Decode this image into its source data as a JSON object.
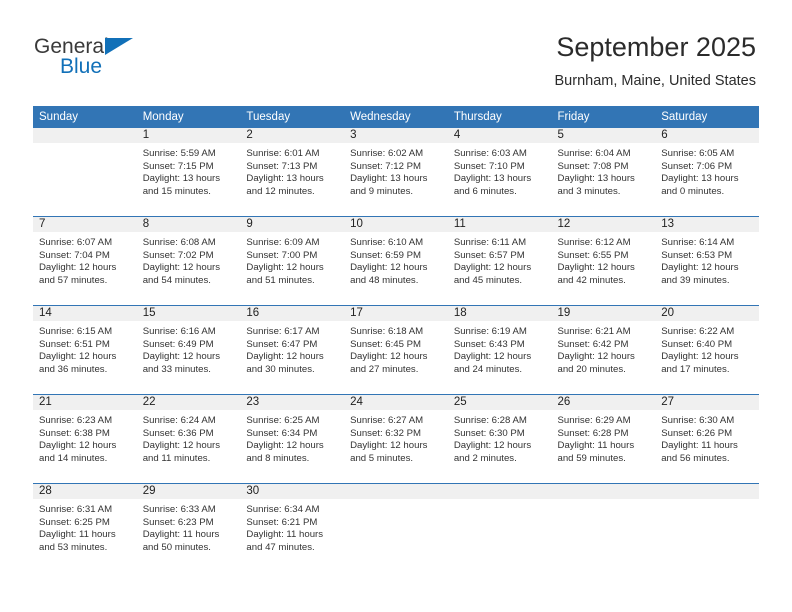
{
  "brand": {
    "word1": "General",
    "word2": "Blue",
    "triangle_color": "#1170b8"
  },
  "header": {
    "title": "September 2025",
    "location": "Burnham, Maine, United States"
  },
  "theme": {
    "header_blue": "#3275b5",
    "day_band_gray": "#f0f0f0",
    "text": "#222222"
  },
  "weekdays": [
    "Sunday",
    "Monday",
    "Tuesday",
    "Wednesday",
    "Thursday",
    "Friday",
    "Saturday"
  ],
  "weeks": [
    [
      {
        "day": "",
        "sunrise": "",
        "sunset": "",
        "daylight_line1": "",
        "daylight_line2": "",
        "empty": true
      },
      {
        "day": "1",
        "sunrise": "Sunrise: 5:59 AM",
        "sunset": "Sunset: 7:15 PM",
        "daylight_line1": "Daylight: 13 hours",
        "daylight_line2": "and 15 minutes."
      },
      {
        "day": "2",
        "sunrise": "Sunrise: 6:01 AM",
        "sunset": "Sunset: 7:13 PM",
        "daylight_line1": "Daylight: 13 hours",
        "daylight_line2": "and 12 minutes."
      },
      {
        "day": "3",
        "sunrise": "Sunrise: 6:02 AM",
        "sunset": "Sunset: 7:12 PM",
        "daylight_line1": "Daylight: 13 hours",
        "daylight_line2": "and 9 minutes."
      },
      {
        "day": "4",
        "sunrise": "Sunrise: 6:03 AM",
        "sunset": "Sunset: 7:10 PM",
        "daylight_line1": "Daylight: 13 hours",
        "daylight_line2": "and 6 minutes."
      },
      {
        "day": "5",
        "sunrise": "Sunrise: 6:04 AM",
        "sunset": "Sunset: 7:08 PM",
        "daylight_line1": "Daylight: 13 hours",
        "daylight_line2": "and 3 minutes."
      },
      {
        "day": "6",
        "sunrise": "Sunrise: 6:05 AM",
        "sunset": "Sunset: 7:06 PM",
        "daylight_line1": "Daylight: 13 hours",
        "daylight_line2": "and 0 minutes."
      }
    ],
    [
      {
        "day": "7",
        "sunrise": "Sunrise: 6:07 AM",
        "sunset": "Sunset: 7:04 PM",
        "daylight_line1": "Daylight: 12 hours",
        "daylight_line2": "and 57 minutes."
      },
      {
        "day": "8",
        "sunrise": "Sunrise: 6:08 AM",
        "sunset": "Sunset: 7:02 PM",
        "daylight_line1": "Daylight: 12 hours",
        "daylight_line2": "and 54 minutes."
      },
      {
        "day": "9",
        "sunrise": "Sunrise: 6:09 AM",
        "sunset": "Sunset: 7:00 PM",
        "daylight_line1": "Daylight: 12 hours",
        "daylight_line2": "and 51 minutes."
      },
      {
        "day": "10",
        "sunrise": "Sunrise: 6:10 AM",
        "sunset": "Sunset: 6:59 PM",
        "daylight_line1": "Daylight: 12 hours",
        "daylight_line2": "and 48 minutes."
      },
      {
        "day": "11",
        "sunrise": "Sunrise: 6:11 AM",
        "sunset": "Sunset: 6:57 PM",
        "daylight_line1": "Daylight: 12 hours",
        "daylight_line2": "and 45 minutes."
      },
      {
        "day": "12",
        "sunrise": "Sunrise: 6:12 AM",
        "sunset": "Sunset: 6:55 PM",
        "daylight_line1": "Daylight: 12 hours",
        "daylight_line2": "and 42 minutes."
      },
      {
        "day": "13",
        "sunrise": "Sunrise: 6:14 AM",
        "sunset": "Sunset: 6:53 PM",
        "daylight_line1": "Daylight: 12 hours",
        "daylight_line2": "and 39 minutes."
      }
    ],
    [
      {
        "day": "14",
        "sunrise": "Sunrise: 6:15 AM",
        "sunset": "Sunset: 6:51 PM",
        "daylight_line1": "Daylight: 12 hours",
        "daylight_line2": "and 36 minutes."
      },
      {
        "day": "15",
        "sunrise": "Sunrise: 6:16 AM",
        "sunset": "Sunset: 6:49 PM",
        "daylight_line1": "Daylight: 12 hours",
        "daylight_line2": "and 33 minutes."
      },
      {
        "day": "16",
        "sunrise": "Sunrise: 6:17 AM",
        "sunset": "Sunset: 6:47 PM",
        "daylight_line1": "Daylight: 12 hours",
        "daylight_line2": "and 30 minutes."
      },
      {
        "day": "17",
        "sunrise": "Sunrise: 6:18 AM",
        "sunset": "Sunset: 6:45 PM",
        "daylight_line1": "Daylight: 12 hours",
        "daylight_line2": "and 27 minutes."
      },
      {
        "day": "18",
        "sunrise": "Sunrise: 6:19 AM",
        "sunset": "Sunset: 6:43 PM",
        "daylight_line1": "Daylight: 12 hours",
        "daylight_line2": "and 24 minutes."
      },
      {
        "day": "19",
        "sunrise": "Sunrise: 6:21 AM",
        "sunset": "Sunset: 6:42 PM",
        "daylight_line1": "Daylight: 12 hours",
        "daylight_line2": "and 20 minutes."
      },
      {
        "day": "20",
        "sunrise": "Sunrise: 6:22 AM",
        "sunset": "Sunset: 6:40 PM",
        "daylight_line1": "Daylight: 12 hours",
        "daylight_line2": "and 17 minutes."
      }
    ],
    [
      {
        "day": "21",
        "sunrise": "Sunrise: 6:23 AM",
        "sunset": "Sunset: 6:38 PM",
        "daylight_line1": "Daylight: 12 hours",
        "daylight_line2": "and 14 minutes."
      },
      {
        "day": "22",
        "sunrise": "Sunrise: 6:24 AM",
        "sunset": "Sunset: 6:36 PM",
        "daylight_line1": "Daylight: 12 hours",
        "daylight_line2": "and 11 minutes."
      },
      {
        "day": "23",
        "sunrise": "Sunrise: 6:25 AM",
        "sunset": "Sunset: 6:34 PM",
        "daylight_line1": "Daylight: 12 hours",
        "daylight_line2": "and 8 minutes."
      },
      {
        "day": "24",
        "sunrise": "Sunrise: 6:27 AM",
        "sunset": "Sunset: 6:32 PM",
        "daylight_line1": "Daylight: 12 hours",
        "daylight_line2": "and 5 minutes."
      },
      {
        "day": "25",
        "sunrise": "Sunrise: 6:28 AM",
        "sunset": "Sunset: 6:30 PM",
        "daylight_line1": "Daylight: 12 hours",
        "daylight_line2": "and 2 minutes."
      },
      {
        "day": "26",
        "sunrise": "Sunrise: 6:29 AM",
        "sunset": "Sunset: 6:28 PM",
        "daylight_line1": "Daylight: 11 hours",
        "daylight_line2": "and 59 minutes."
      },
      {
        "day": "27",
        "sunrise": "Sunrise: 6:30 AM",
        "sunset": "Sunset: 6:26 PM",
        "daylight_line1": "Daylight: 11 hours",
        "daylight_line2": "and 56 minutes."
      }
    ],
    [
      {
        "day": "28",
        "sunrise": "Sunrise: 6:31 AM",
        "sunset": "Sunset: 6:25 PM",
        "daylight_line1": "Daylight: 11 hours",
        "daylight_line2": "and 53 minutes."
      },
      {
        "day": "29",
        "sunrise": "Sunrise: 6:33 AM",
        "sunset": "Sunset: 6:23 PM",
        "daylight_line1": "Daylight: 11 hours",
        "daylight_line2": "and 50 minutes."
      },
      {
        "day": "30",
        "sunrise": "Sunrise: 6:34 AM",
        "sunset": "Sunset: 6:21 PM",
        "daylight_line1": "Daylight: 11 hours",
        "daylight_line2": "and 47 minutes."
      },
      {
        "day": "",
        "sunrise": "",
        "sunset": "",
        "daylight_line1": "",
        "daylight_line2": "",
        "empty": true
      },
      {
        "day": "",
        "sunrise": "",
        "sunset": "",
        "daylight_line1": "",
        "daylight_line2": "",
        "empty": true
      },
      {
        "day": "",
        "sunrise": "",
        "sunset": "",
        "daylight_line1": "",
        "daylight_line2": "",
        "empty": true
      },
      {
        "day": "",
        "sunrise": "",
        "sunset": "",
        "daylight_line1": "",
        "daylight_line2": "",
        "empty": true
      }
    ]
  ]
}
